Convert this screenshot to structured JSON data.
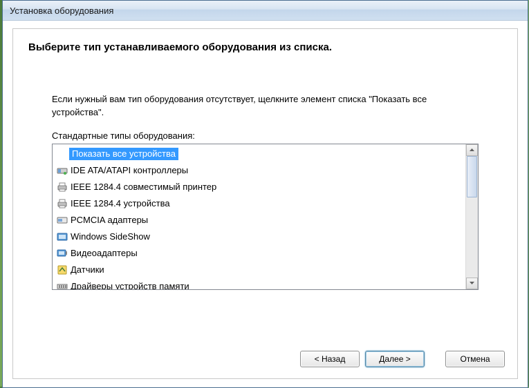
{
  "window": {
    "title": "Установка оборудования"
  },
  "heading": "Выберите тип устанавливаемого оборудования из списка.",
  "hint": "Если нужный вам тип оборудования отсутствует, щелкните элемент списка \"Показать все устройства\".",
  "list_label": "Стандартные типы оборудования:",
  "hardware_types": [
    {
      "label": "Показать все устройства",
      "icon": "all",
      "selected": true
    },
    {
      "label": "IDE ATA/ATAPI контроллеры",
      "icon": "ide",
      "selected": false
    },
    {
      "label": "IEEE 1284.4 совместимый принтер",
      "icon": "printer",
      "selected": false
    },
    {
      "label": "IEEE 1284.4 устройства",
      "icon": "printer",
      "selected": false
    },
    {
      "label": "PCMCIA адаптеры",
      "icon": "pcmcia",
      "selected": false
    },
    {
      "label": "Windows SideShow",
      "icon": "sideshow",
      "selected": false
    },
    {
      "label": "Видеоадаптеры",
      "icon": "video",
      "selected": false
    },
    {
      "label": "Датчики",
      "icon": "sensor",
      "selected": false
    },
    {
      "label": "Драйверы устройств памяти",
      "icon": "memory",
      "selected": false
    }
  ],
  "buttons": {
    "back": "< Назад",
    "next": "Далее >",
    "cancel": "Отмена"
  }
}
